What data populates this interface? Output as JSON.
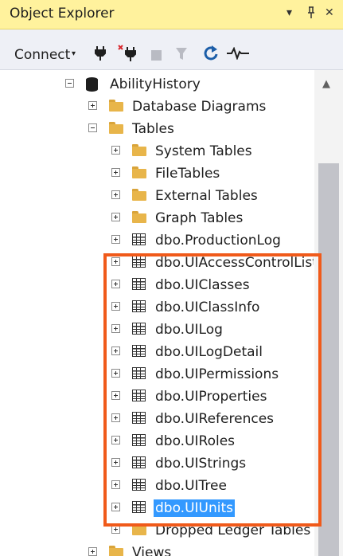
{
  "panel": {
    "title": "Object Explorer",
    "dropdown_glyph": "▾",
    "pin_glyph": "🖈",
    "close_glyph": "✕"
  },
  "toolbar": {
    "connect_label": "Connect",
    "connect_caret": "▾",
    "icons": [
      "connect-plug-icon",
      "disconnect-plug-icon",
      "stop-icon",
      "filter-icon",
      "refresh-icon",
      "activity-monitor-icon"
    ]
  },
  "tree": {
    "database": "AbilityHistory",
    "nodes": [
      {
        "label": "Database Diagrams",
        "type": "folder"
      },
      {
        "label": "Tables",
        "type": "folder",
        "expanded": true
      },
      {
        "label": "System Tables",
        "type": "folder"
      },
      {
        "label": "FileTables",
        "type": "folder"
      },
      {
        "label": "External Tables",
        "type": "folder"
      },
      {
        "label": "Graph Tables",
        "type": "folder"
      },
      {
        "label": "dbo.ProductionLog",
        "type": "table"
      },
      {
        "label": "dbo.UIAccessControlLists",
        "type": "table"
      },
      {
        "label": "dbo.UIClasses",
        "type": "table"
      },
      {
        "label": "dbo.UIClassInfo",
        "type": "table"
      },
      {
        "label": "dbo.UILog",
        "type": "table"
      },
      {
        "label": "dbo.UILogDetail",
        "type": "table"
      },
      {
        "label": "dbo.UIPermissions",
        "type": "table"
      },
      {
        "label": "dbo.UIProperties",
        "type": "table"
      },
      {
        "label": "dbo.UIReferences",
        "type": "table"
      },
      {
        "label": "dbo.UIRoles",
        "type": "table"
      },
      {
        "label": "dbo.UIStrings",
        "type": "table"
      },
      {
        "label": "dbo.UITree",
        "type": "table"
      },
      {
        "label": "dbo.UIUnits",
        "type": "table",
        "selected": true
      },
      {
        "label": "Dropped Ledger Tables",
        "type": "folder"
      },
      {
        "label": "Views",
        "type": "folder"
      }
    ]
  },
  "colors": {
    "title_bar": "#fff29d",
    "toolbar": "#eef0f6",
    "selection": "#3399ff",
    "highlight_box": "#f05a1a",
    "folder": "#e8b54a"
  }
}
